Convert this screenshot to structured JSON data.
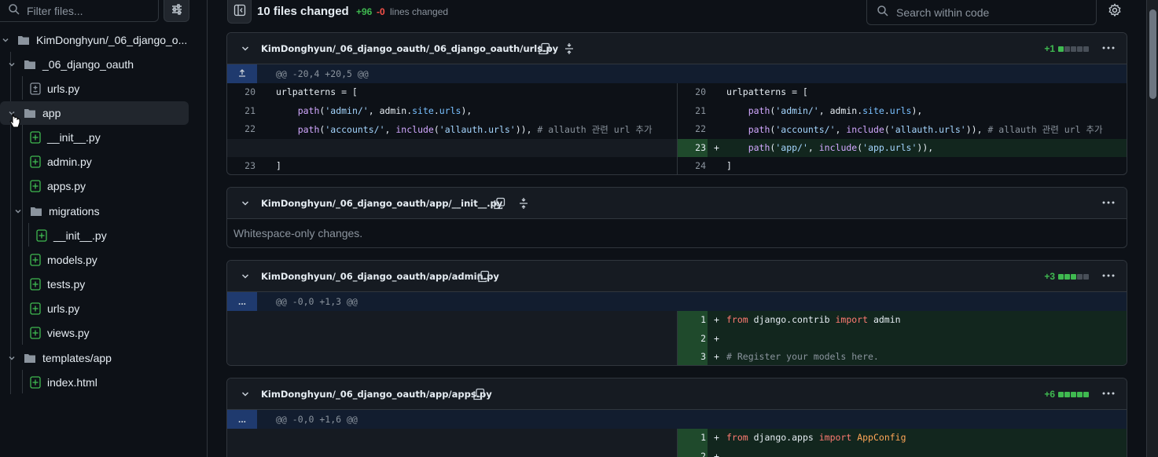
{
  "sidebar": {
    "filter_placeholder": "Filter files...",
    "tree": [
      {
        "label": "KimDonghyun/_06_django_o...",
        "type": "folder",
        "depth": 0,
        "expanded": true
      },
      {
        "label": "_06_django_oauth",
        "type": "folder",
        "depth": 1,
        "expanded": true
      },
      {
        "label": "urls.py",
        "type": "file-modified",
        "depth": 2
      },
      {
        "label": "app",
        "type": "folder",
        "depth": 1,
        "expanded": true,
        "selected": true
      },
      {
        "label": "__init__.py",
        "type": "file-added",
        "depth": 2
      },
      {
        "label": "admin.py",
        "type": "file-added",
        "depth": 2
      },
      {
        "label": "apps.py",
        "type": "file-added",
        "depth": 2
      },
      {
        "label": "migrations",
        "type": "folder",
        "depth": 2,
        "expanded": true
      },
      {
        "label": "__init__.py",
        "type": "file-added",
        "depth": 3
      },
      {
        "label": "models.py",
        "type": "file-added",
        "depth": 2
      },
      {
        "label": "tests.py",
        "type": "file-added",
        "depth": 2
      },
      {
        "label": "urls.py",
        "type": "file-added",
        "depth": 2
      },
      {
        "label": "views.py",
        "type": "file-added",
        "depth": 2
      },
      {
        "label": "templates/app",
        "type": "folder",
        "depth": 1,
        "expanded": true
      },
      {
        "label": "index.html",
        "type": "file-added",
        "depth": 2
      }
    ]
  },
  "toolbar": {
    "files_changed": "10 files changed",
    "additions": "+96",
    "deletions": "-0",
    "lines_changed": "lines changed",
    "search_placeholder": "Search within code"
  },
  "files": [
    {
      "name": "KimDonghyun/_06_django_oauth/_06_django_oauth/urls.py",
      "stat": "+1",
      "stat_squares": [
        "add",
        "neutral",
        "neutral",
        "neutral",
        "neutral"
      ],
      "hunk": "@@ -20,4 +20,5 @@"
    },
    {
      "name": "KimDonghyun/_06_django_oauth/app/__init__.py",
      "note": "Whitespace-only changes."
    },
    {
      "name": "KimDonghyun/_06_django_oauth/app/admin.py",
      "stat": "+3",
      "stat_squares": [
        "add",
        "add",
        "add",
        "neutral",
        "neutral"
      ],
      "hunk": "@@ -0,0 +1,3 @@",
      "hunk_btn": "..."
    },
    {
      "name": "KimDonghyun/_06_django_oauth/app/apps.py",
      "stat": "+6",
      "stat_squares": [
        "add",
        "add",
        "add",
        "add",
        "add"
      ],
      "hunk": "@@ -0,0 +1,6 @@",
      "hunk_btn": "..."
    }
  ],
  "colors": {
    "bg": "#0d1117",
    "add": "#3fb950",
    "del": "#f85149",
    "border": "#30363d"
  }
}
